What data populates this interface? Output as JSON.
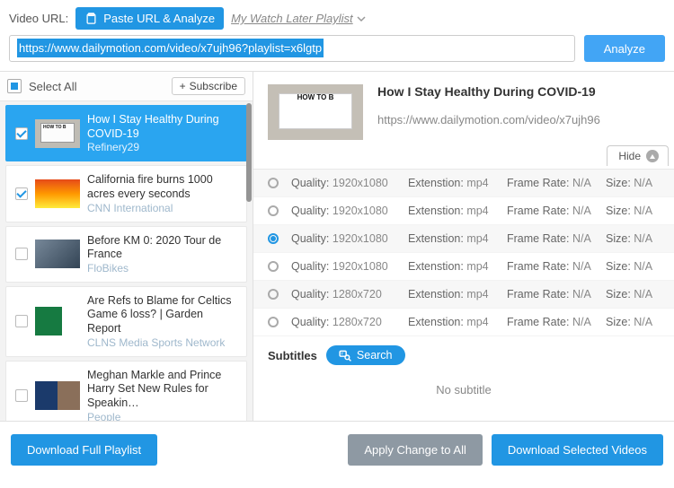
{
  "header": {
    "url_label": "Video URL:",
    "paste_btn": "Paste URL & Analyze",
    "watch_later": "My Watch Later Playlist",
    "url_value": "https://www.dailymotion.com/video/x7ujh96?playlist=x6lgtp",
    "analyze": "Analyze"
  },
  "list_header": {
    "select_all": "Select All",
    "subscribe": "Subscribe"
  },
  "items": [
    {
      "title": "How I Stay Healthy During COVID-19",
      "source": "Refinery29",
      "checked": true,
      "selected": true,
      "thumb": "slide",
      "thumb_text": "HOW TO B"
    },
    {
      "title": "California fire burns 1000 acres every seconds",
      "source": "CNN International",
      "checked": true,
      "selected": false,
      "thumb": "fire"
    },
    {
      "title": "Before KM 0: 2020 Tour de France",
      "source": "FloBikes",
      "checked": false,
      "selected": false,
      "thumb": "bike"
    },
    {
      "title": "Are Refs to Blame for Celtics Game 6 loss? | Garden Report",
      "source": "CLNS Media Sports Network",
      "checked": false,
      "selected": false,
      "thumb": "bball"
    },
    {
      "title": "Meghan Markle and Prince Harry Set New Rules for Speakin…",
      "source": "People",
      "checked": false,
      "selected": false,
      "thumb": "news"
    }
  ],
  "detail": {
    "title": "How I Stay Healthy During COVID-19",
    "url": "https://www.dailymotion.com/video/x7ujh96",
    "thumb_text": "HOW TO B",
    "hide": "Hide"
  },
  "labels": {
    "quality": "Quality:",
    "ext": "Extenstion:",
    "fr": "Frame Rate:",
    "size": "Size:"
  },
  "formats": [
    {
      "q": "1920x1080",
      "ext": "mp4",
      "fr": "N/A",
      "size": "N/A",
      "sel": false
    },
    {
      "q": "1920x1080",
      "ext": "mp4",
      "fr": "N/A",
      "size": "N/A",
      "sel": false
    },
    {
      "q": "1920x1080",
      "ext": "mp4",
      "fr": "N/A",
      "size": "N/A",
      "sel": true
    },
    {
      "q": "1920x1080",
      "ext": "mp4",
      "fr": "N/A",
      "size": "N/A",
      "sel": false
    },
    {
      "q": "1280x720",
      "ext": "mp4",
      "fr": "N/A",
      "size": "N/A",
      "sel": false
    },
    {
      "q": "1280x720",
      "ext": "mp4",
      "fr": "N/A",
      "size": "N/A",
      "sel": false
    }
  ],
  "subs": {
    "heading": "Subtitles",
    "search": "Search",
    "none": "No subtitle"
  },
  "footer": {
    "dl_full": "Download Full Playlist",
    "apply_all": "Apply Change to All",
    "dl_sel": "Download Selected Videos"
  }
}
